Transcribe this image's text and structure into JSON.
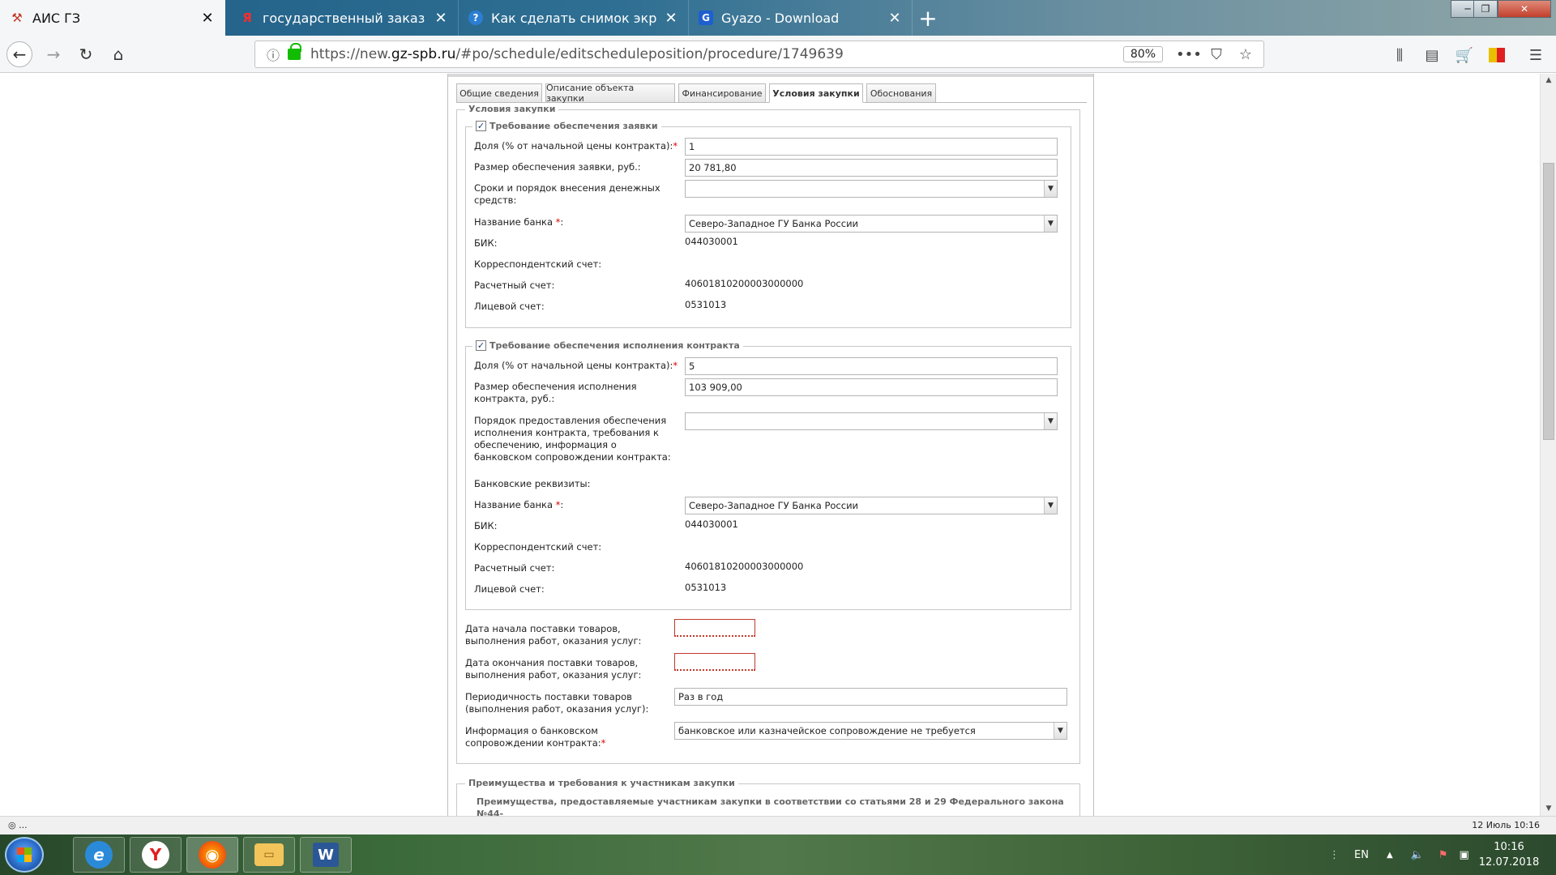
{
  "browser": {
    "tabs": [
      {
        "title": "АИС ГЗ",
        "active": true,
        "icon": "ais-icon"
      },
      {
        "title": "государственный заказ санкт",
        "active": false,
        "icon": "yandex-icon"
      },
      {
        "title": "Как сделать снимок экрана (с",
        "active": false,
        "icon": "help-icon"
      },
      {
        "title": "Gyazo - Download",
        "active": false,
        "icon": "gyazo-icon"
      }
    ],
    "url_prefix": "https://new.",
    "url_host": "gz-spb.ru",
    "url_path": "/#po/schedule/editscheduleposition/procedure/1749639",
    "zoom": "80%"
  },
  "form": {
    "tabs": [
      "Общие сведения",
      "Описание объекта закупки",
      "Финансирование",
      "Условия закупки",
      "Обоснования"
    ],
    "active_tab": "Условия закупки",
    "section_title": "Условия закупки",
    "bid_security": {
      "legend": "Требование обеспечения заявки",
      "checked": true,
      "share_label": "Доля (% от начальной цены контракта):",
      "share_value": "1",
      "amount_label": "Размер обеспечения заявки, руб.:",
      "amount_value": "20 781,80",
      "terms_label": "Сроки и порядок внесения денежных средств:",
      "terms_value": "",
      "bank_label": "Название банка",
      "bank_value": "Северо-Западное ГУ Банка России",
      "bik_label": "БИК:",
      "bik_value": "044030001",
      "corr_label": "Корреспондентский счет:",
      "corr_value": "",
      "settle_label": "Расчетный счет:",
      "settle_value": "40601810200003000000",
      "personal_label": "Лицевой счет:",
      "personal_value": "0531013"
    },
    "contract_security": {
      "legend": "Требование обеспечения исполнения контракта",
      "checked": true,
      "share_label": "Доля (% от начальной цены контракта):",
      "share_value": "5",
      "amount_label": "Размер обеспечения исполнения контракта, руб.:",
      "amount_value": "103 909,00",
      "order_label": "Порядок предоставления обеспечения исполнения контракта, требования к обеспечению, информация о банковском сопровождении контракта:",
      "order_value": "",
      "bank_details_label": "Банковские реквизиты:",
      "bank_label": "Название банка",
      "bank_value": "Северо-Западное ГУ Банка России",
      "bik_label": "БИК:",
      "bik_value": "044030001",
      "corr_label": "Корреспондентский счет:",
      "corr_value": "",
      "settle_label": "Расчетный счет:",
      "settle_value": "40601810200003000000",
      "personal_label": "Лицевой счет:",
      "personal_value": "0531013"
    },
    "delivery": {
      "start_label": "Дата начала поставки товаров, выполнения работ, оказания услуг:",
      "start_value": "",
      "end_label": "Дата окончания поставки товаров, выполнения работ, оказания услуг:",
      "end_value": "",
      "period_label": "Периодичность поставки товаров (выполнения работ, оказания услуг):",
      "period_value": "Раз в год",
      "bank_support_label": "Информация о банковском сопровождении контракта:",
      "bank_support_value": "банковское или казначейское сопровождение не требуется"
    },
    "advantages": {
      "legend": "Преимущества и требования к участникам закупки",
      "subtitle": "Преимущества, предоставляемые участникам закупки в соответствии со статьями 28 и 29 Федерального закона №44-"
    },
    "required_mark": "*"
  },
  "status": {
    "left": "◎ ...",
    "right": "12 Июль 10:16"
  },
  "taskbar": {
    "lang": "EN",
    "time": "10:16",
    "date": "12.07.2018"
  },
  "colors": {
    "accent_link": "#1c3d6e",
    "required": "#dd0000",
    "error_border": "#c0392b"
  }
}
